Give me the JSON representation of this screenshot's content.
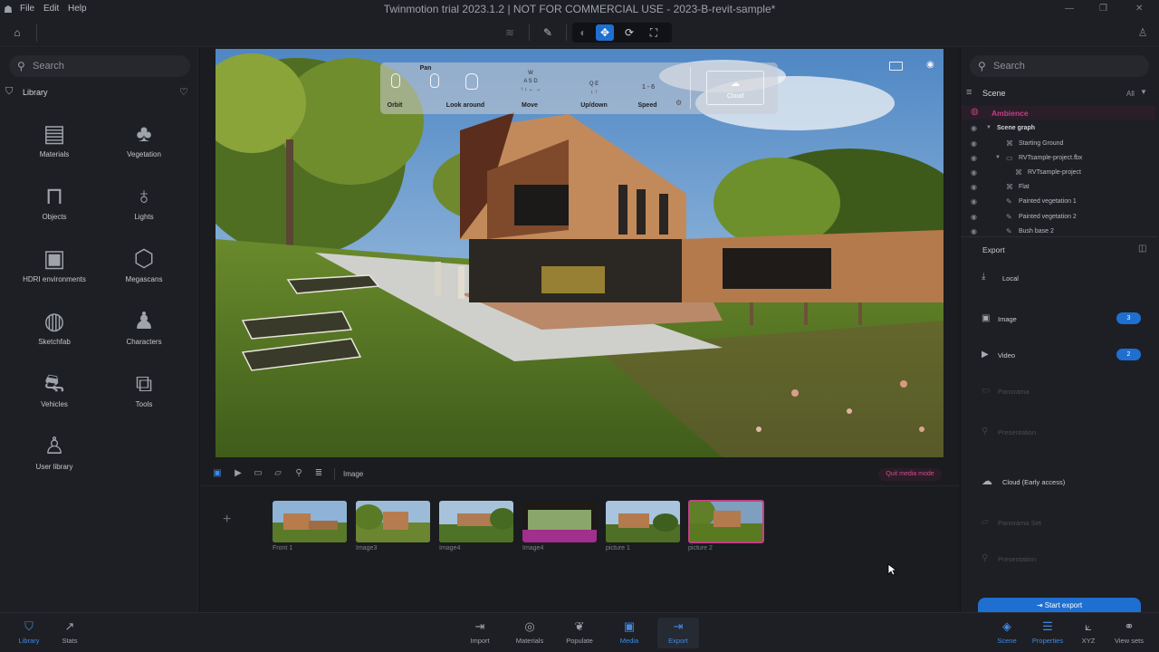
{
  "window": {
    "title": "Twinmotion trial 2023.1.2 | NOT FOR COMMERCIAL USE - 2023-B-revit-sample*",
    "menu": [
      "File",
      "Edit",
      "Help"
    ]
  },
  "search": {
    "left_placeholder": "Search",
    "right_placeholder": "Search"
  },
  "library": {
    "title": "Library",
    "items": [
      {
        "label": "Materials",
        "icon": "materials-icon"
      },
      {
        "label": "Vegetation",
        "icon": "vegetation-icon"
      },
      {
        "label": "Objects",
        "icon": "objects-icon"
      },
      {
        "label": "Lights",
        "icon": "lights-icon"
      },
      {
        "label": "HDRI environments",
        "icon": "hdri-icon"
      },
      {
        "label": "Megascans",
        "icon": "megascans-icon"
      },
      {
        "label": "Sketchfab",
        "icon": "sketchfab-icon"
      },
      {
        "label": "Characters",
        "icon": "characters-icon"
      },
      {
        "label": "Vehicles",
        "icon": "vehicles-icon"
      },
      {
        "label": "Tools",
        "icon": "tools-icon"
      },
      {
        "label": "User library",
        "icon": "user-library-icon"
      }
    ]
  },
  "navhelp": {
    "orbit": "Orbit",
    "pan": "Pan",
    "look_around": "Look around",
    "move": "Move",
    "updown": "Up/down",
    "speed": "Speed",
    "speed_keys": "1 - 6",
    "cloud": "Cloud"
  },
  "media": {
    "type_label": "Image",
    "quit_label": "Quit media mode",
    "thumbnails": [
      {
        "label": "Front 1",
        "selected": false
      },
      {
        "label": "Image3",
        "selected": false
      },
      {
        "label": "Image4",
        "selected": false
      },
      {
        "label": "Image4",
        "selected": false
      },
      {
        "label": "picture 1",
        "selected": false
      },
      {
        "label": "picture 2",
        "selected": true
      }
    ]
  },
  "scene": {
    "title": "Scene",
    "filter": "All",
    "ambience": "Ambience",
    "graph_title": "Scene graph",
    "items": [
      {
        "label": "Starting Ground",
        "indent": 1
      },
      {
        "label": "RVTsample-project.fbx",
        "indent": 1
      },
      {
        "label": "RVTsample-project",
        "indent": 2
      },
      {
        "label": "Flat",
        "indent": 1
      },
      {
        "label": "Painted vegetation 1",
        "indent": 1
      },
      {
        "label": "Painted vegetation 2",
        "indent": 1
      },
      {
        "label": "Bush base 2",
        "indent": 1
      }
    ]
  },
  "export": {
    "title": "Export",
    "local": "Local",
    "image": "Image",
    "image_count": "3",
    "video": "Video",
    "video_count": "2",
    "panorama": "Panorama",
    "presentation": "Presentation",
    "cloud": "Cloud (Early access)",
    "panorama_set": "Panorama Set",
    "presentation_cloud": "Presentation",
    "start_export": "Start export"
  },
  "bottombar": {
    "left": [
      {
        "label": "Library",
        "active": true
      },
      {
        "label": "Stats",
        "active": false
      }
    ],
    "center": [
      {
        "label": "Import",
        "active": false
      },
      {
        "label": "Materials",
        "active": false
      },
      {
        "label": "Populate",
        "active": false
      },
      {
        "label": "Media",
        "active": true
      },
      {
        "label": "Export",
        "active": true
      }
    ],
    "right": [
      {
        "label": "Scene",
        "active": true
      },
      {
        "label": "Properties",
        "active": true
      },
      {
        "label": "XYZ",
        "active": false
      },
      {
        "label": "View sets",
        "active": false
      }
    ]
  },
  "colors": {
    "accent": "#1f6fd1",
    "media_pink": "#c43f86",
    "panel": "#1e1f24"
  }
}
